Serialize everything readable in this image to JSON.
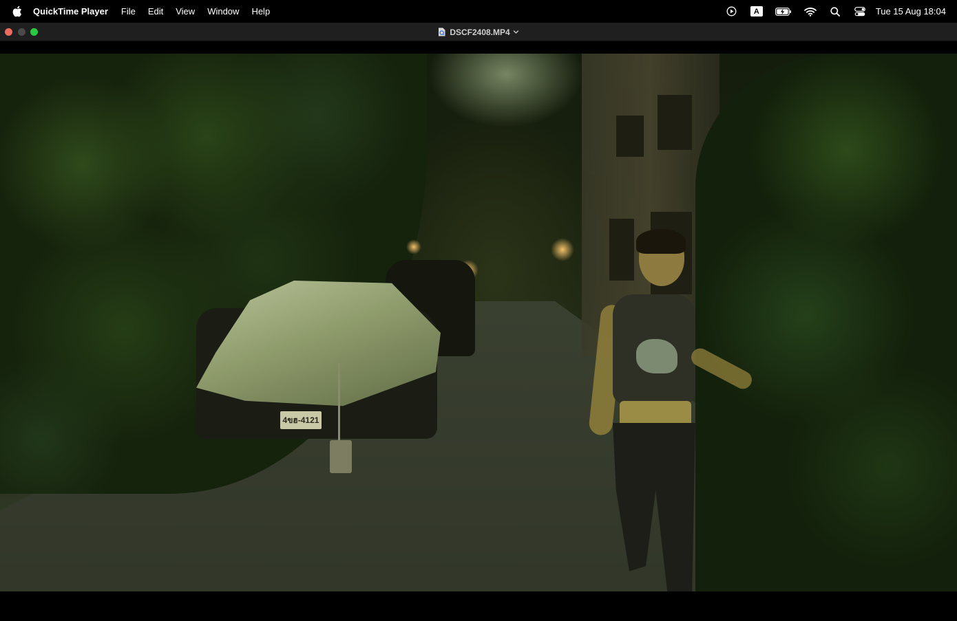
{
  "menubar": {
    "app_name": "QuickTime Player",
    "items": [
      {
        "label": "File"
      },
      {
        "label": "Edit"
      },
      {
        "label": "View"
      },
      {
        "label": "Window"
      },
      {
        "label": "Help"
      }
    ],
    "status_icons": {
      "media": "play-circle-icon",
      "input_source": "A",
      "battery": "battery-charging-icon",
      "wifi": "wifi-icon",
      "search": "spotlight-search-icon",
      "control_center": "control-center-icon"
    },
    "clock": "Tue 15 Aug  18:04"
  },
  "window": {
    "title": "DSCF2408.MP4",
    "traffic_colors": {
      "close": "#ed6a5e",
      "minimize": "#4a4a4a",
      "maximize": "#2bc840"
    }
  },
  "video": {
    "plate_text": "4ขฮ-4121"
  }
}
